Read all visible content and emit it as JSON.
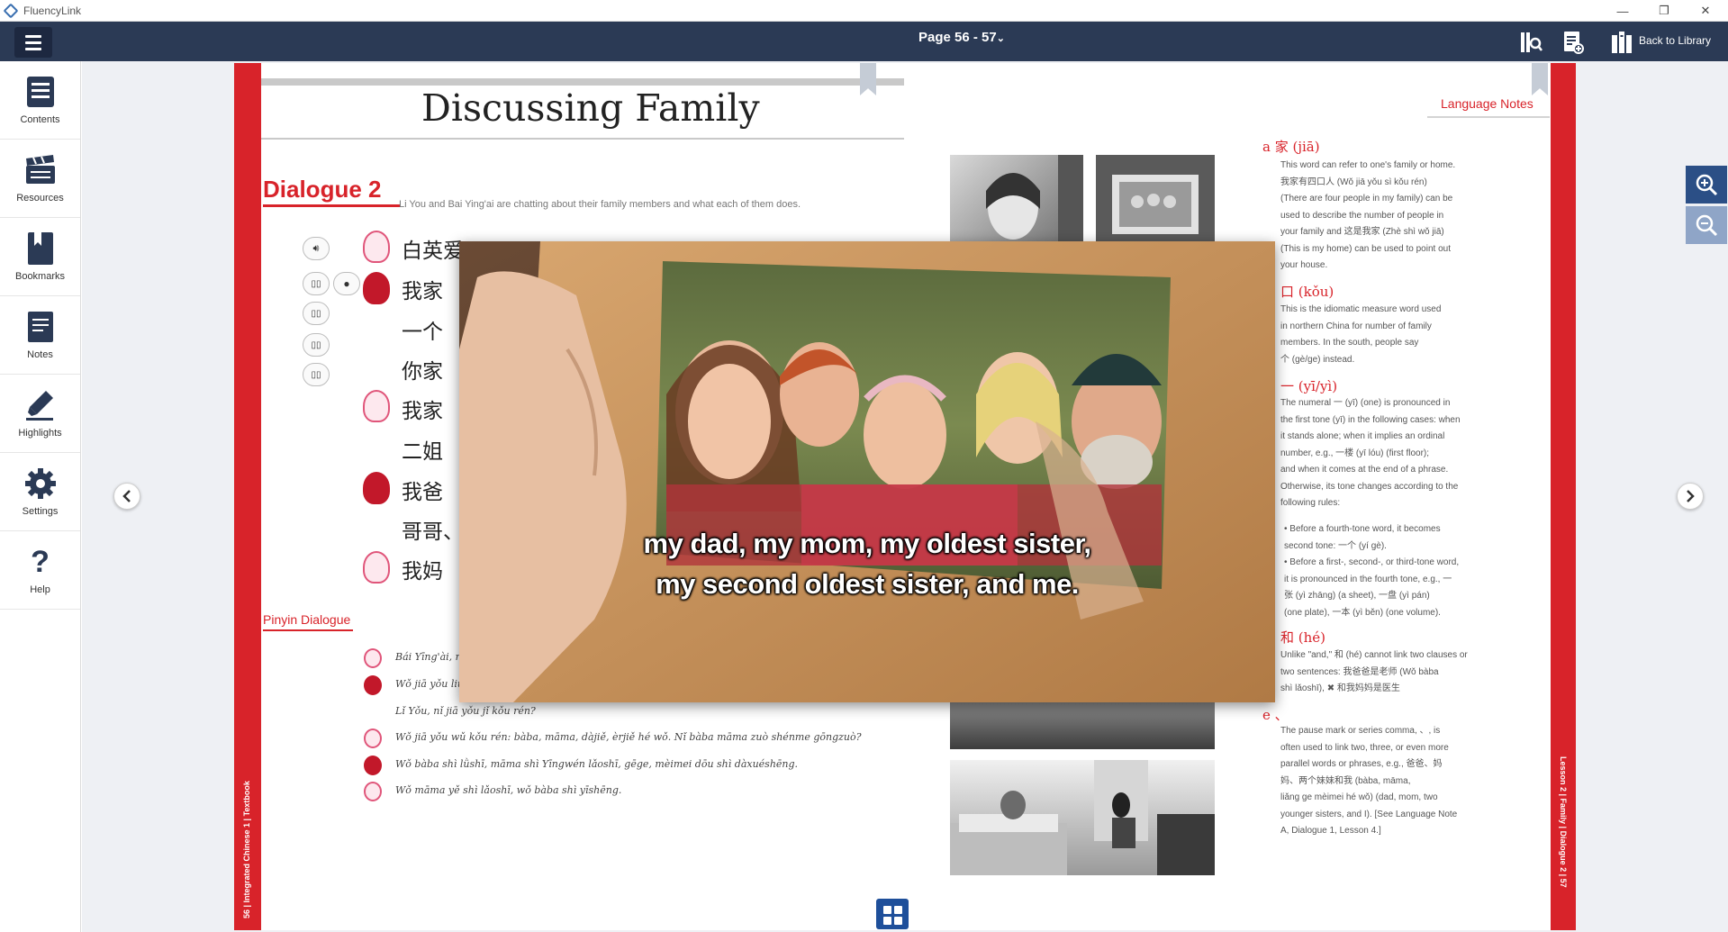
{
  "window": {
    "title": "FluencyLink",
    "minimize": "—",
    "maximize": "❐",
    "close": "✕"
  },
  "toolbar": {
    "page_indicator": "Page 56 - 57",
    "back_to_library": "Back to Library"
  },
  "sidebar": {
    "items": [
      {
        "label": "Contents",
        "icon": "contents-icon"
      },
      {
        "label": "Resources",
        "icon": "clapperboard-icon"
      },
      {
        "label": "Bookmarks",
        "icon": "bookmark-icon"
      },
      {
        "label": "Notes",
        "icon": "note-icon"
      },
      {
        "label": "Highlights",
        "icon": "highlighter-icon"
      },
      {
        "label": "Settings",
        "icon": "gear-icon"
      },
      {
        "label": "Help",
        "icon": "help-icon"
      }
    ]
  },
  "page_left": {
    "title": "Discussing Family",
    "dialogue_title": "Dialogue 2",
    "dialogue_desc": "Li You and Bai Ying'ai are chatting about their family members and what each of them does.",
    "chinese_lines": [
      "白英爱",
      "我家",
      "一个",
      "你家",
      "我家",
      "二姐",
      "我爸",
      "哥哥、",
      "我妈"
    ],
    "pinyin_title": "Pinyin Dialogue",
    "pinyin_lines": [
      "Bái Yīng'ài, nǐ",
      "Wǒ jiā yǒu liù",
      "Lǐ Yǒu, nǐ jiā yǒu jǐ kǒu rén?",
      "Wǒ jiā yǒu wǔ kǒu rén: bàba, māma, dàjiě, èrjiě hé wǒ. Nǐ bàba māma zuò shénme gōngzuò?",
      "Wǒ bàba shì lǜshī, māma shì Yīngwén lǎoshī, gēge, mèimei dōu shì dàxuéshēng.",
      "Wǒ māma yě shì lǎoshī, wǒ bàba shì yīshēng."
    ],
    "strip_text": "56 | Integrated Chinese 1 | Textbook"
  },
  "page_right": {
    "language_notes": "Language Notes",
    "strip_text": "Lesson 2 | Family | Dialogue 2 | 57",
    "notes": [
      {
        "head": "a  家 (jiā)",
        "lines": [
          "This word can refer to one's family or home.",
          "我家有四口人 (Wǒ jiā yǒu sì kǒu rén)",
          "(There are four people in my family) can be",
          "used to describe the number of people in",
          "your family and 这是我家 (Zhè shì wǒ jiā)",
          "(This is my home) can be used to point out",
          "your house."
        ]
      },
      {
        "head": "口 (kǒu)",
        "lines": [
          "This is the idiomatic measure word used",
          "in northern China for number of family",
          "members. In the south, people say",
          "个 (gè/ge) instead."
        ]
      },
      {
        "head": "一 (yī/yì)",
        "lines": [
          "The numeral 一 (yī) (one) is pronounced in",
          "the first tone (yī) in the following cases: when",
          "it stands alone; when it implies an ordinal",
          "number, e.g., 一楼 (yī lóu) (first floor);",
          "and when it comes at the end of a phrase.",
          "Otherwise, its tone changes according to the",
          "following rules:"
        ]
      },
      {
        "head": "",
        "lines": [
          "•  Before a fourth-tone word, it becomes",
          "    second tone: 一个 (yí gè).",
          "•  Before a first-, second-, or third-tone word,",
          "    it is pronounced in the fourth tone, e.g., 一",
          "    张 (yì zhāng) (a sheet), 一盘 (yì pán)",
          "    (one plate), 一本 (yì běn) (one volume)."
        ]
      },
      {
        "head": "和 (hé)",
        "lines": [
          "Unlike \"and,\" 和 (hé) cannot link two clauses or",
          "two sentences: 我爸爸是老师 (Wǒ bàba",
          "shì lǎoshī), ✖ 和我妈妈是医生"
        ]
      },
      {
        "head": "e  、",
        "lines": [
          "The pause mark or series comma, 、, is",
          "often used to link two, three, or even more",
          "parallel words or phrases, e.g., 爸爸、妈",
          "妈、两个妹妹和我 (bàba, māma,",
          "liǎng ge mèimei hé wǒ) (dad, mom, two",
          "younger sisters, and I). [See Language Note",
          "A, Dialogue 1, Lesson 4.]"
        ]
      }
    ]
  },
  "video": {
    "subtitle_line1": "my dad, my mom, my oldest sister,",
    "subtitle_line2": "my second oldest sister, and me."
  },
  "colors": {
    "toolbar": "#2b3a55",
    "accent_red": "#d8232a",
    "zoom": "#2b4f86",
    "grid_button": "#1e4f9a"
  }
}
